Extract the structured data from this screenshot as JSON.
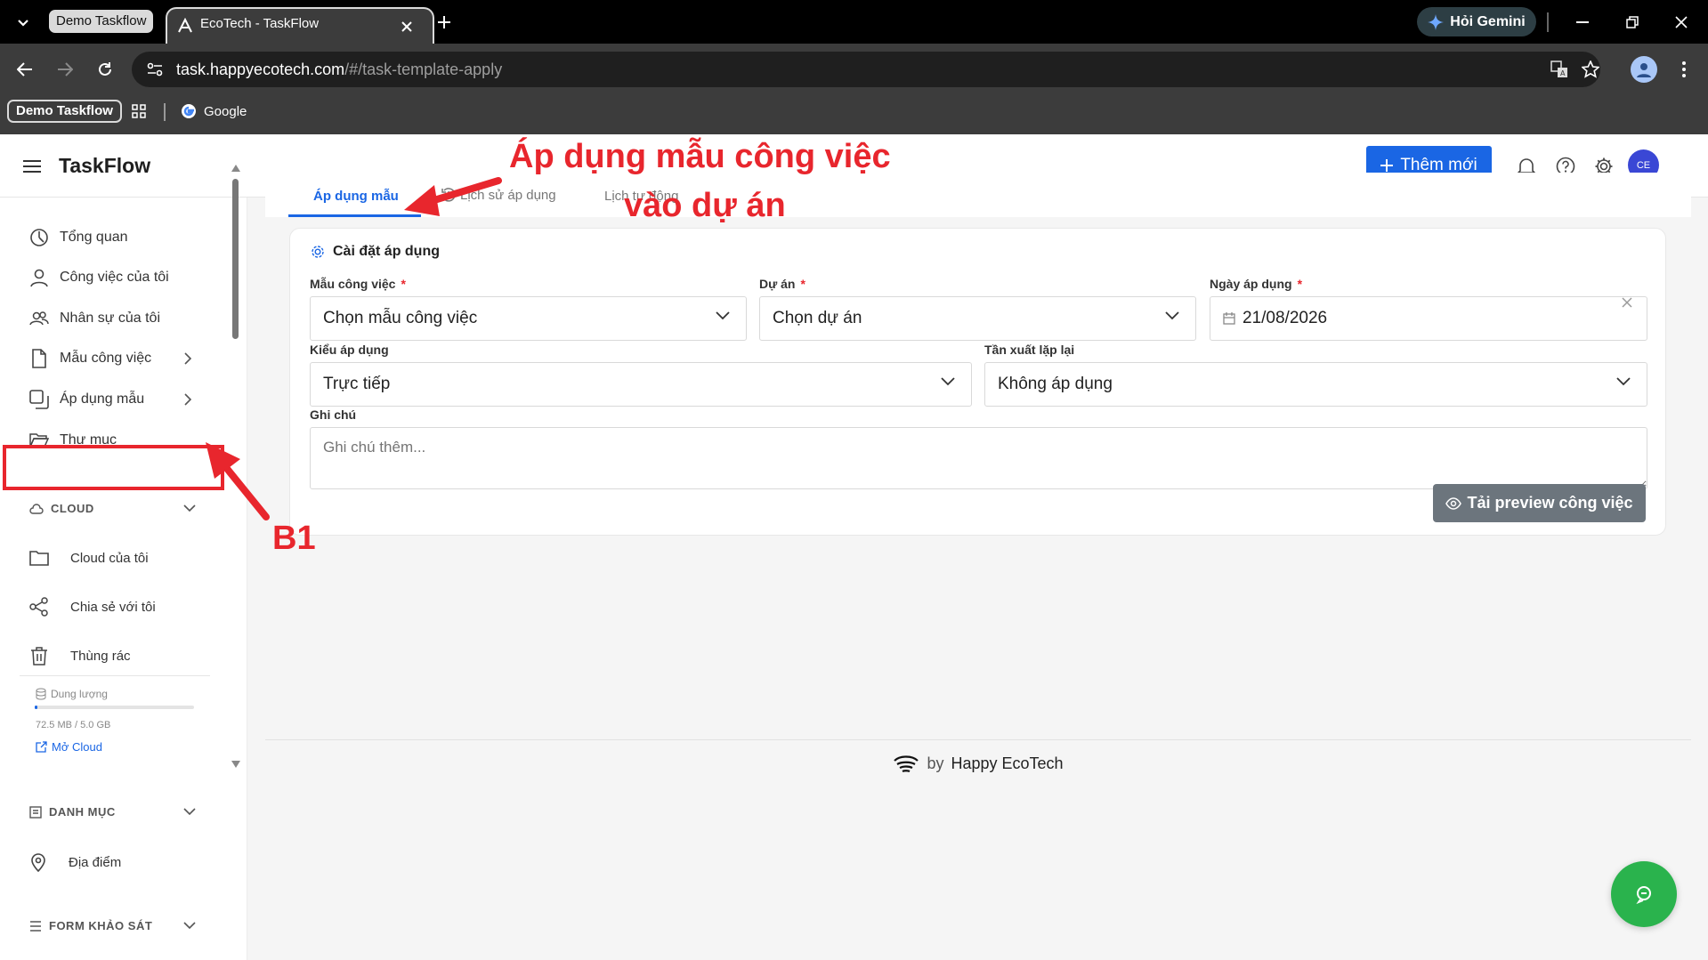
{
  "browser": {
    "tab_group_label": "Demo Taskflow",
    "tab_title": "EcoTech - TaskFlow",
    "gemini_label": "Hỏi Gemini",
    "url_host": "task.happyecotech.com",
    "url_path": "/#/task-template-apply",
    "bookmarks": [
      {
        "label": "Demo Taskflow"
      },
      {
        "label": "Google"
      }
    ]
  },
  "header": {
    "brand": "TaskFlow",
    "add_button": "Thêm mới",
    "avatar_initials": "CE"
  },
  "sidebar": {
    "items": [
      {
        "label": "Tổng quan",
        "icon": "dashboard-icon"
      },
      {
        "label": "Công việc của tôi",
        "icon": "user-icon"
      },
      {
        "label": "Nhân sự của tôi",
        "icon": "users-icon"
      },
      {
        "label": "Mẫu công việc",
        "icon": "file-icon"
      },
      {
        "label": "Áp dụng mẫu",
        "icon": "copy-icon"
      },
      {
        "label": "Thư mục",
        "icon": "folder-open-icon"
      }
    ],
    "cloud": {
      "section": "CLOUD",
      "items": [
        {
          "label": "Cloud của tôi"
        },
        {
          "label": "Chia sẻ với tôi"
        },
        {
          "label": "Thùng rác"
        }
      ],
      "storage_label": "Dung lượng",
      "storage_text": "72.5 MB / 5.0 GB",
      "storage_fraction": 0.015,
      "open_cloud": "Mở Cloud"
    },
    "catalog": {
      "section": "DANH MỤC",
      "items": [
        {
          "label": "Địa điểm"
        }
      ]
    },
    "survey": {
      "section": "FORM KHẢO SÁT"
    }
  },
  "content": {
    "tabs": [
      {
        "label": "Áp dụng mẫu",
        "active": true
      },
      {
        "label": "Lịch sử áp dụng",
        "active": false
      },
      {
        "label": "Lịch tự động",
        "active": false
      }
    ],
    "card_title": "Cài đặt áp dụng",
    "fields": {
      "template": {
        "label": "Mẫu công việc",
        "value": "Chọn mẫu công việc"
      },
      "project": {
        "label": "Dự án",
        "value": "Chọn dự án"
      },
      "date": {
        "label": "Ngày áp dụng",
        "value": "21/08/2026"
      },
      "apply_type": {
        "label": "Kiểu áp dụng",
        "value": "Trực tiếp"
      },
      "repeat": {
        "label": "Tần xuất lặp lại",
        "value": "Không áp dụng"
      },
      "note": {
        "label": "Ghi chú",
        "placeholder": "Ghi chú thêm..."
      }
    },
    "preview_button": "Tải preview công việc"
  },
  "footer": {
    "by": "by",
    "company": "Happy EcoTech"
  },
  "annotations": {
    "title_line1": "Áp dụng mẫu công việc",
    "title_line2": "vào dự án",
    "step": "B1"
  },
  "colors": {
    "primary": "#1a66e4",
    "annotation": "#e8262d",
    "fab": "#2ab34d",
    "preview_button": "#6c757d"
  }
}
